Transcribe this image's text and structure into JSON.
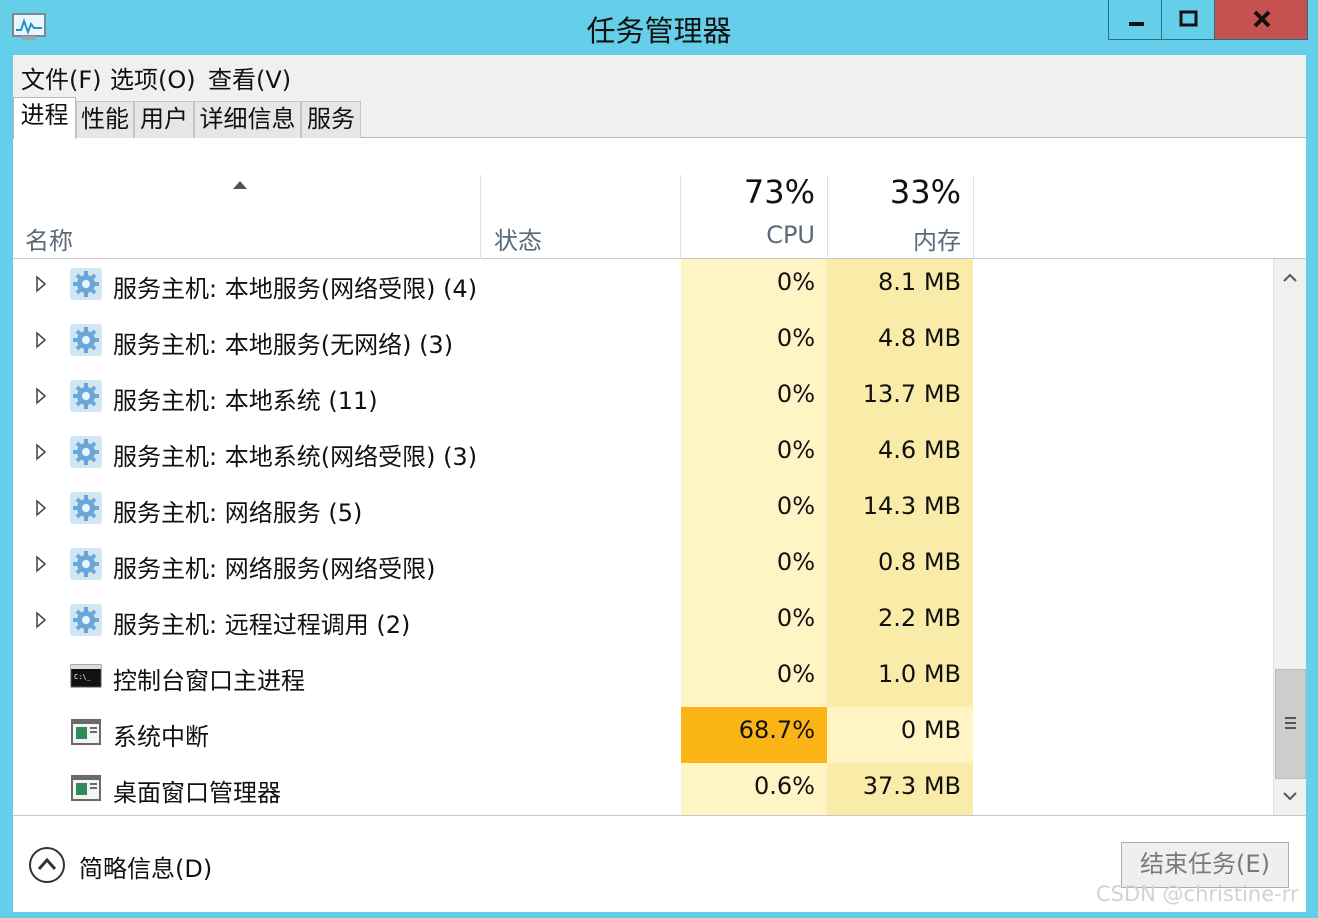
{
  "window": {
    "title": "任务管理器",
    "accent_color": "#65cfe9",
    "close_color": "#c75050"
  },
  "menu": {
    "items": [
      "文件(F)",
      "选项(O)",
      "查看(V)"
    ]
  },
  "tabs": [
    "进程",
    "性能",
    "用户",
    "详细信息",
    "服务"
  ],
  "active_tab": "进程",
  "columns": {
    "name": "名称",
    "status": "状态",
    "cpu_pct": "73%",
    "cpu": "CPU",
    "mem_pct": "33%",
    "mem": "内存"
  },
  "processes": [
    {
      "name": "服务主机: 本地服务(网络受限) (4)",
      "icon": "gear-icon",
      "expandable": true,
      "cpu": "0%",
      "mem": "8.1 MB"
    },
    {
      "name": "服务主机: 本地服务(无网络) (3)",
      "icon": "gear-icon",
      "expandable": true,
      "cpu": "0%",
      "mem": "4.8 MB"
    },
    {
      "name": "服务主机: 本地系统 (11)",
      "icon": "gear-icon",
      "expandable": true,
      "cpu": "0%",
      "mem": "13.7 MB"
    },
    {
      "name": "服务主机: 本地系统(网络受限) (3)",
      "icon": "gear-icon",
      "expandable": true,
      "cpu": "0%",
      "mem": "4.6 MB"
    },
    {
      "name": "服务主机: 网络服务 (5)",
      "icon": "gear-icon",
      "expandable": true,
      "cpu": "0%",
      "mem": "14.3 MB"
    },
    {
      "name": "服务主机: 网络服务(网络受限)",
      "icon": "gear-icon",
      "expandable": true,
      "cpu": "0%",
      "mem": "0.8 MB"
    },
    {
      "name": "服务主机: 远程过程调用 (2)",
      "icon": "gear-icon",
      "expandable": true,
      "cpu": "0%",
      "mem": "2.2 MB"
    },
    {
      "name": "控制台窗口主进程",
      "icon": "console-icon",
      "expandable": false,
      "cpu": "0%",
      "mem": "1.0 MB"
    },
    {
      "name": "系统中断",
      "icon": "window-app-icon",
      "expandable": false,
      "cpu": "68.7%",
      "mem": "0 MB"
    },
    {
      "name": "桌面窗口管理器",
      "icon": "window-app-icon",
      "expandable": false,
      "cpu": "0.6%",
      "mem": "37.3 MB"
    }
  ],
  "heat_colors": {
    "low": "#fff4c4",
    "mem_low": "#f9eca8",
    "high": "#fbb415",
    "zero_mem": "#fff4c4"
  },
  "footer": {
    "fewer_details": "简略信息(D)",
    "end_task": "结束任务(E)"
  },
  "watermark": "CSDN @christine-rr"
}
